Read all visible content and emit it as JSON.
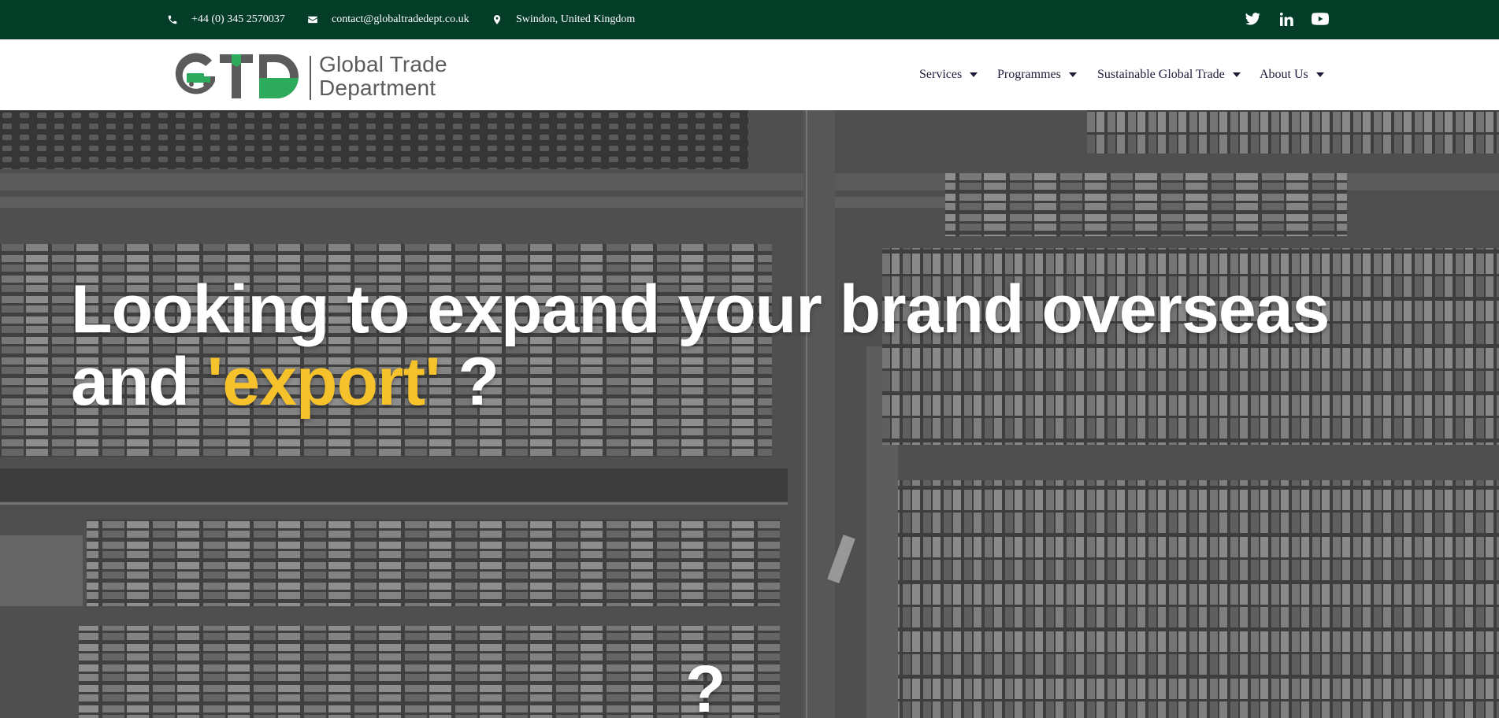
{
  "topbar": {
    "phone": "+44 (0) 345 2570037",
    "email": "contact@globaltradedept.co.uk",
    "location": "Swindon, United Kingdom",
    "social": [
      "twitter-icon",
      "linkedin-icon",
      "youtube-icon"
    ]
  },
  "logo": {
    "letters": "GTD",
    "line1": "Global Trade",
    "line2": "Department"
  },
  "nav": {
    "items": [
      {
        "label": "Services"
      },
      {
        "label": "Programmes"
      },
      {
        "label": "Sustainable Global Trade"
      },
      {
        "label": "About Us"
      }
    ]
  },
  "hero": {
    "line1": "Looking to expand your brand overseas",
    "line2_prefix": "and ",
    "line2_highlight": "'export'",
    "line2_suffix": " ?",
    "bottom_mark": "?"
  },
  "colors": {
    "topbar_bg": "#033d28",
    "accent_yellow": "#f5c22c",
    "logo_green": "#2eaa5c",
    "logo_grey": "#5b5b5b",
    "nav_text": "#1d1d3a"
  }
}
